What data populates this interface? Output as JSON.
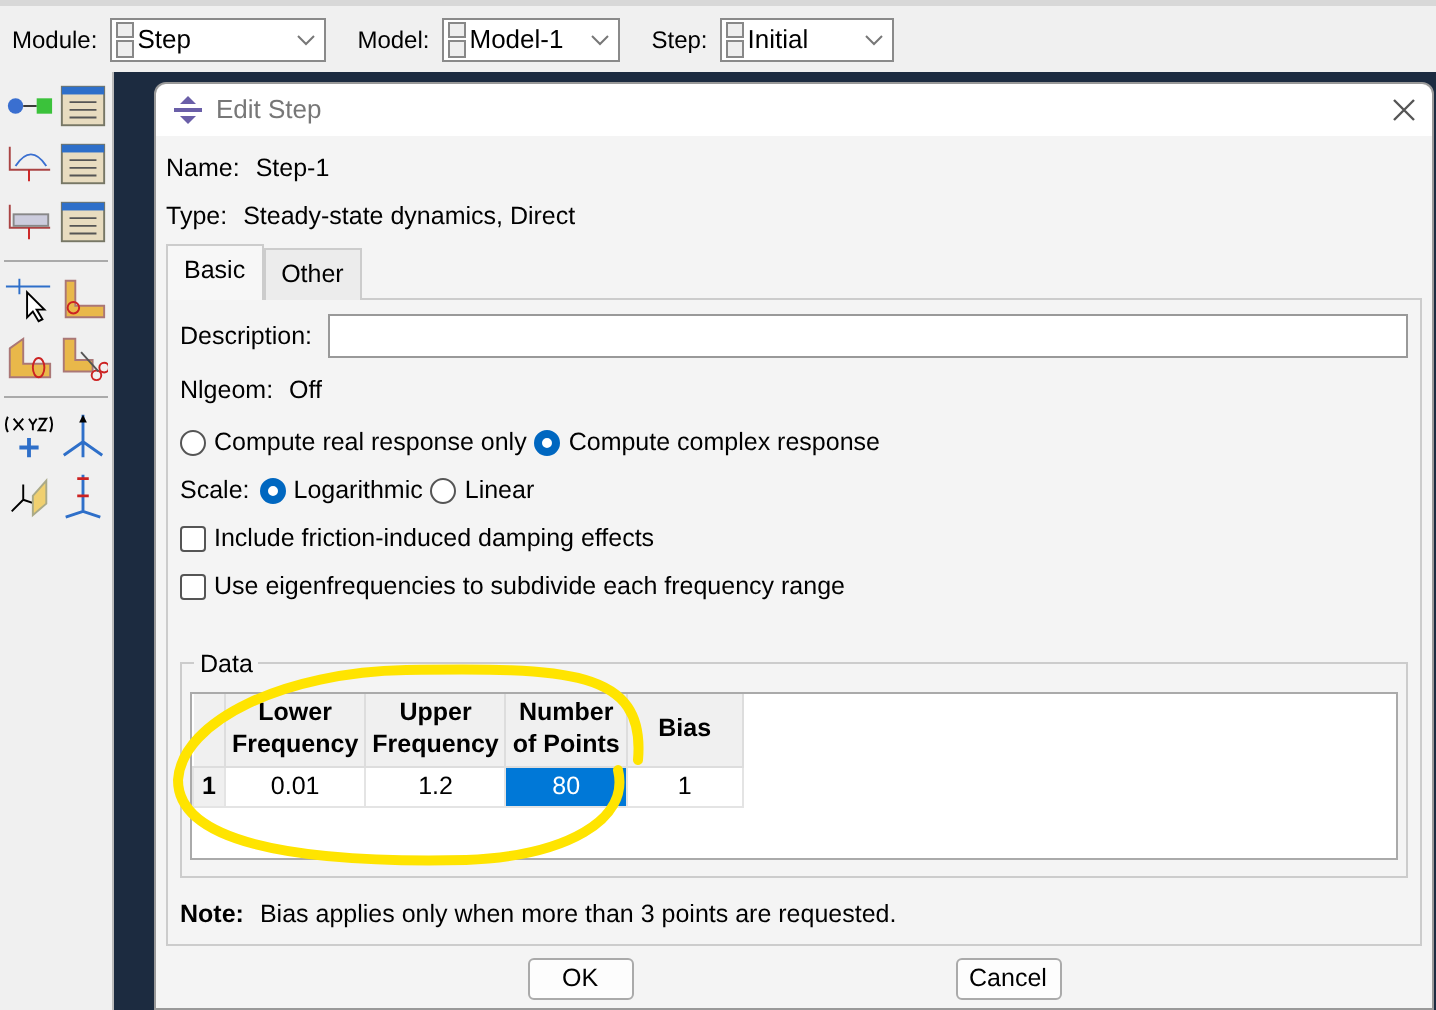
{
  "toolbar": {
    "fields": [
      {
        "label": "Module:",
        "value": "Step"
      },
      {
        "label": "Model:",
        "value": "Model-1"
      },
      {
        "label": "Step:",
        "value": "Initial"
      }
    ]
  },
  "dialog": {
    "title": "Edit Step",
    "name_label": "Name:",
    "name": "Step-1",
    "type_label": "Type:",
    "type": "Steady-state dynamics, Direct",
    "tabs": [
      {
        "label": "Basic",
        "selected": true
      },
      {
        "label": "Other",
        "selected": false
      }
    ],
    "description_label": "Description:",
    "nlgeom_label": "Nlgeom:",
    "nlgeom": "Off",
    "response_options": [
      {
        "label": "Compute real response only",
        "selected": false
      },
      {
        "label": "Compute complex response",
        "selected": true
      }
    ],
    "scale_label": "Scale:",
    "scale_options": [
      {
        "label": "Logarithmic",
        "selected": true
      },
      {
        "label": "Linear",
        "selected": false
      }
    ],
    "checkboxes": [
      {
        "label": "Include friction-induced damping effects",
        "checked": false
      },
      {
        "label": "Use eigenfrequencies to subdivide each frequency range",
        "checked": false
      }
    ],
    "data": {
      "title": "Data",
      "columns": [
        "Lower\nFrequency",
        "Upper\nFrequency",
        "Number\nof Points",
        "Bias"
      ],
      "rows": [
        {
          "index": "1",
          "cells": [
            {
              "text": "0.01",
              "selected": false
            },
            {
              "text": "1.2",
              "selected": false
            },
            {
              "text": "80",
              "selected": true
            },
            {
              "text": "1",
              "selected": false
            }
          ]
        }
      ]
    },
    "note_label": "Note:",
    "note": "Bias applies only when more than 3 points are requested.",
    "buttons": [
      "OK",
      "Cancel"
    ]
  }
}
